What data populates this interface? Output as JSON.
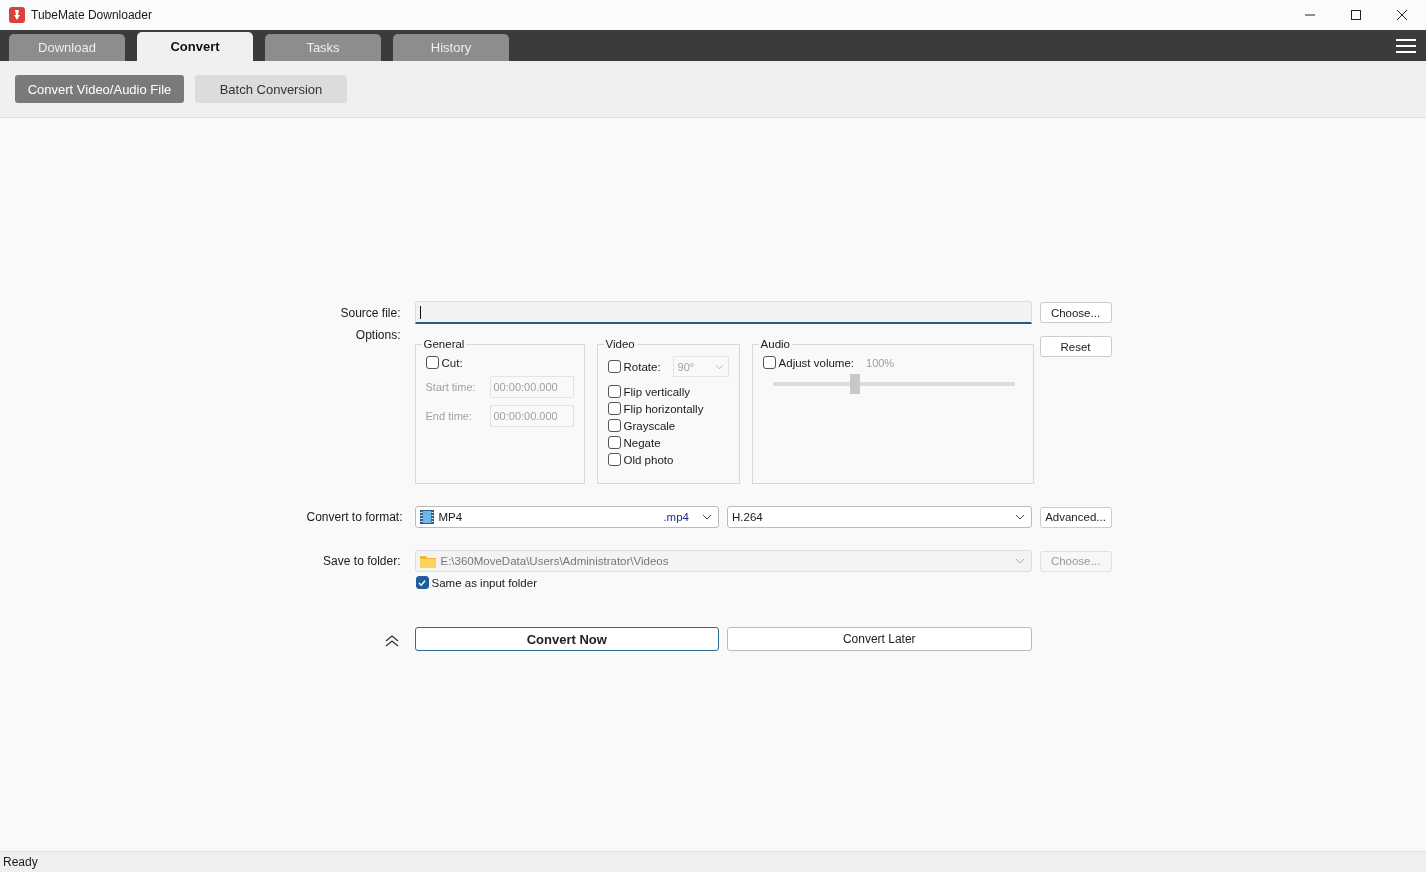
{
  "window": {
    "title": "TubeMate Downloader"
  },
  "tabs": [
    {
      "label": "Download",
      "selected": false
    },
    {
      "label": "Convert",
      "selected": true
    },
    {
      "label": "Tasks",
      "selected": false
    },
    {
      "label": "History",
      "selected": false
    }
  ],
  "subtabs": [
    {
      "label": "Convert Video/Audio File",
      "selected": true
    },
    {
      "label": "Batch Conversion",
      "selected": false
    }
  ],
  "source": {
    "label": "Source file:",
    "choose": "Choose..."
  },
  "options": {
    "label": "Options:",
    "reset": "Reset",
    "general": {
      "title": "General",
      "cut": {
        "label": "Cut:",
        "checked": false
      },
      "fields": [
        {
          "label": "Start time:",
          "value": "00:00:00.000"
        },
        {
          "label": "End time:",
          "value": "00:00:00.000"
        }
      ]
    },
    "video": {
      "title": "Video",
      "rotate": {
        "label": "Rotate:",
        "checked": false,
        "value": "90°"
      },
      "checks": [
        {
          "label": "Flip vertically",
          "checked": false
        },
        {
          "label": "Flip horizontally",
          "checked": false
        },
        {
          "label": "Grayscale",
          "checked": false
        },
        {
          "label": "Negate",
          "checked": false
        },
        {
          "label": "Old photo",
          "checked": false
        }
      ]
    },
    "audio": {
      "title": "Audio",
      "adjust": {
        "label": "Adjust volume:",
        "checked": false
      },
      "reading": "100%",
      "level": 0.34
    }
  },
  "format": {
    "label": "Convert to format:",
    "name": "MP4",
    "ext": ".mp4",
    "codec": "H.264",
    "advanced": "Advanced..."
  },
  "save": {
    "label": "Save to folder:",
    "path": "E:\\360MoveData\\Users\\Administrator\\Videos",
    "disabled": true,
    "choose": "Choose...",
    "same": {
      "label": "Same as input folder",
      "checked": true
    }
  },
  "actions": {
    "convert_now": "Convert Now",
    "convert_later": "Convert Later"
  },
  "status_bar": "Ready"
}
